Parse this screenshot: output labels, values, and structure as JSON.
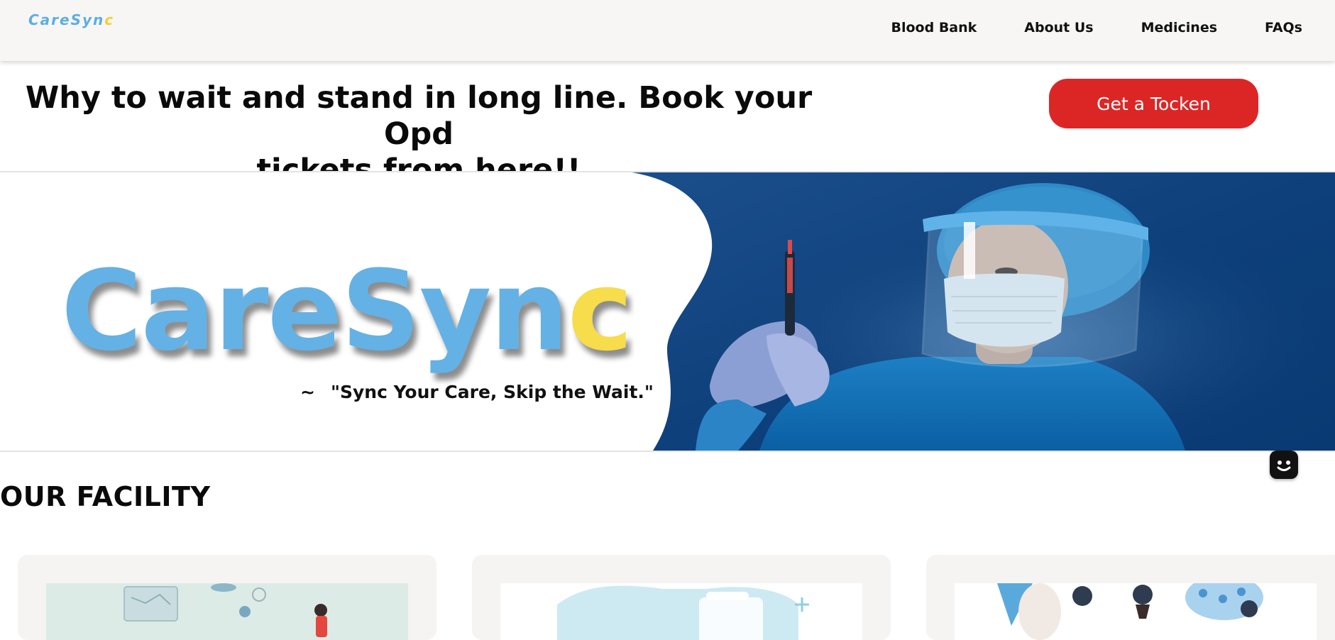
{
  "header": {
    "logo_text": "CareSyn",
    "logo_accent": "c",
    "nav": [
      {
        "label": "Blood Bank"
      },
      {
        "label": "About Us"
      },
      {
        "label": "Medicines"
      },
      {
        "label": "FAQs"
      }
    ]
  },
  "hero_top": {
    "headline_line1": "Why to wait and stand in long line. Book your Opd",
    "headline_line2": "tickets from here!!",
    "cta_label": "Get a Tocken"
  },
  "banner": {
    "brand_main": "CareSyn",
    "brand_accent": "c",
    "tagline_prefix": "~",
    "tagline": "\"Sync Your Care, Skip the Wait.\""
  },
  "facility": {
    "title": "OUR FACILITY",
    "cards": [
      {
        "illustration": "lab-doctors-illustration"
      },
      {
        "illustration": "medical-clipboard-illustration"
      },
      {
        "illustration": "people-pills-illustration"
      }
    ]
  },
  "chat": {
    "icon": "chat-bot-icon"
  },
  "colors": {
    "brand_blue": "#64b1e5",
    "brand_yellow": "#f7dc4c",
    "cta_red": "#dc2626",
    "banner_navy": "#0d3f7a"
  }
}
